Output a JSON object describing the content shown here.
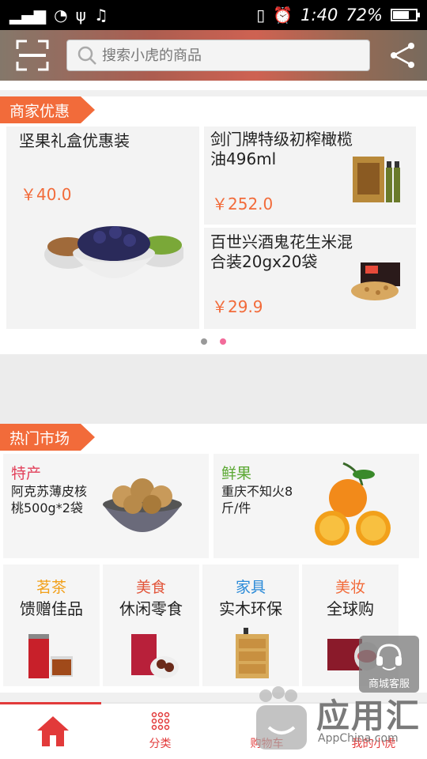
{
  "status_bar": {
    "time": "1:40",
    "battery": "72%",
    "battery_level": 0.72
  },
  "search": {
    "placeholder": "搜索小虎的商品"
  },
  "promo": {
    "section_title": "商家优惠",
    "items": [
      {
        "title": "坚果礼盒优惠装",
        "price": "￥40.0"
      },
      {
        "title": "剑门牌特级初榨橄榄油496ml",
        "price": "￥252.0"
      },
      {
        "title": "百世兴酒鬼花生米混合装20gx20袋",
        "price": "￥29.9"
      }
    ]
  },
  "market": {
    "section_title": "热门市场",
    "big": [
      {
        "category": "特产",
        "desc": "阿克苏薄皮核桃500g*2袋",
        "color": "#e2405a"
      },
      {
        "category": "鲜果",
        "desc": "重庆不知火8斤/件",
        "color": "#5aa832"
      }
    ],
    "small": [
      {
        "category": "茗茶",
        "desc": "馈赠佳品",
        "color": "#f2a01a"
      },
      {
        "category": "美食",
        "desc": "休闲零食",
        "color": "#e2553a"
      },
      {
        "category": "家具",
        "desc": "实木环保",
        "color": "#2a8ad8"
      },
      {
        "category": "美妆",
        "desc": "全球购",
        "color": "#f26b3a"
      }
    ]
  },
  "kefu": {
    "label": "商城客服"
  },
  "bottom_nav": [
    {
      "label": "",
      "icon": "home-icon"
    },
    {
      "label": "分类",
      "icon": "grid-icon"
    },
    {
      "label": "购物车",
      "icon": "cart-icon"
    },
    {
      "label": "我的小虎",
      "icon": "user-icon"
    }
  ],
  "watermark": {
    "title": "应用汇",
    "sub": "AppChina.com"
  },
  "colors": {
    "accent": "#f26b3a",
    "nav_red": "#e23a3a"
  }
}
